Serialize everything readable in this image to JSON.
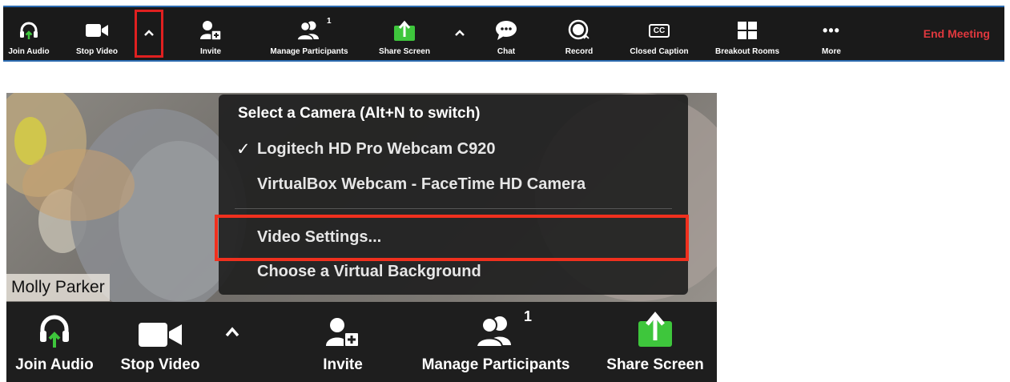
{
  "colors": {
    "toolbar_bg": "#1a1a1a",
    "accent_green": "#3ec63c",
    "end_meeting_red": "#e0383e",
    "highlight_red": "#f0301e"
  },
  "top_toolbar": {
    "join_audio": "Join Audio",
    "stop_video": "Stop Video",
    "invite": "Invite",
    "manage_participants": "Manage Participants",
    "participants_count": "1",
    "share_screen": "Share Screen",
    "chat": "Chat",
    "record": "Record",
    "closed_caption": "Closed Caption",
    "cc_icon_text": "CC",
    "breakout_rooms": "Breakout Rooms",
    "more": "More",
    "more_dots": "•••",
    "end_meeting": "End Meeting"
  },
  "camera_menu": {
    "title": "Select a Camera (Alt+N to switch)",
    "check": "✓",
    "options": [
      {
        "label": "Logitech HD Pro Webcam C920",
        "selected": true
      },
      {
        "label": "VirtualBox Webcam - FaceTime HD Camera",
        "selected": false
      }
    ],
    "video_settings": "Video Settings...",
    "virtual_background": "Choose a Virtual Background"
  },
  "video": {
    "participant_name": "Molly Parker"
  },
  "bottom_toolbar": {
    "join_audio": "Join Audio",
    "stop_video": "Stop Video",
    "invite": "Invite",
    "manage_participants": "Manage Participants",
    "participants_count": "1",
    "share_screen": "Share Screen"
  }
}
